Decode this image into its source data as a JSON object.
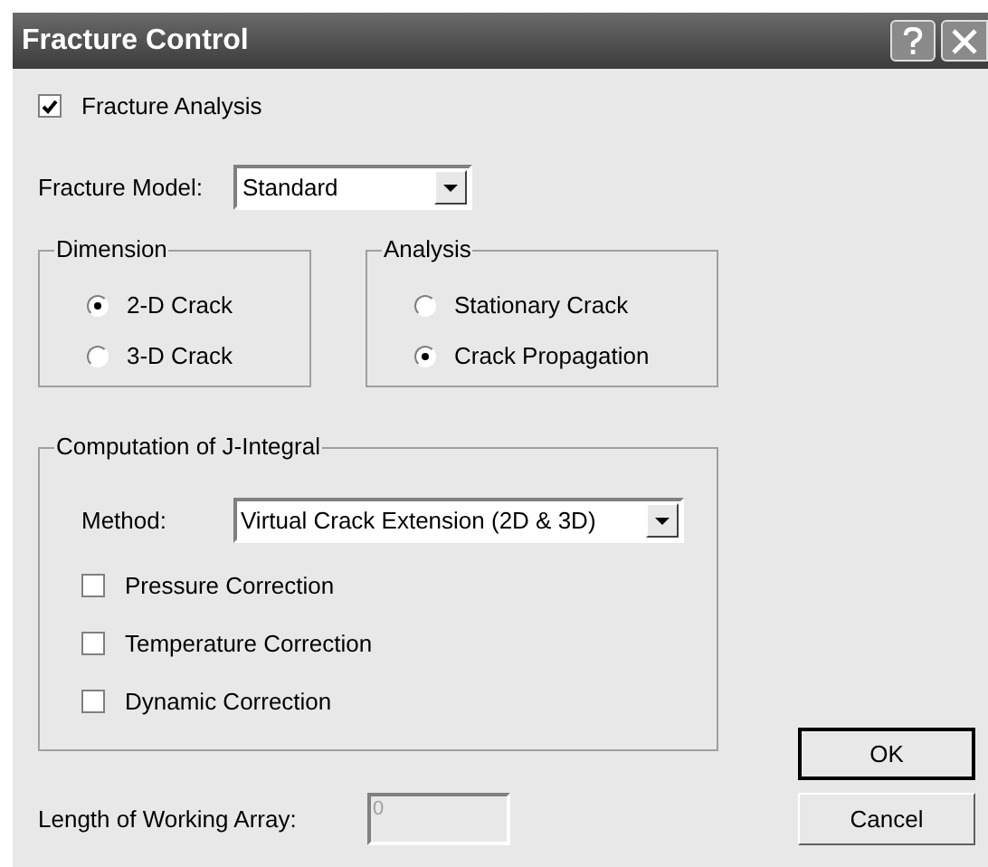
{
  "window": {
    "title": "Fracture Control"
  },
  "fracture_analysis": {
    "label": "Fracture Analysis",
    "checked": true
  },
  "fracture_model": {
    "label": "Fracture Model:",
    "value": "Standard"
  },
  "dimension": {
    "title": "Dimension",
    "options": [
      {
        "label": "2-D Crack",
        "selected": true
      },
      {
        "label": "3-D Crack",
        "selected": false
      }
    ]
  },
  "analysis": {
    "title": "Analysis",
    "options": [
      {
        "label": "Stationary Crack",
        "selected": false
      },
      {
        "label": "Crack Propagation",
        "selected": true
      }
    ]
  },
  "j_integral": {
    "title": "Computation of J-Integral",
    "method_label": "Method:",
    "method_value": "Virtual Crack Extension (2D & 3D)",
    "corrections": [
      {
        "label": "Pressure Correction",
        "checked": false
      },
      {
        "label": "Temperature Correction",
        "checked": false
      },
      {
        "label": "Dynamic Correction",
        "checked": false
      }
    ]
  },
  "working_array": {
    "label": "Length of Working Array:",
    "value": "0",
    "disabled": true
  },
  "buttons": [
    {
      "label": "OK",
      "default": true
    },
    {
      "label": "Cancel",
      "default": false
    }
  ]
}
